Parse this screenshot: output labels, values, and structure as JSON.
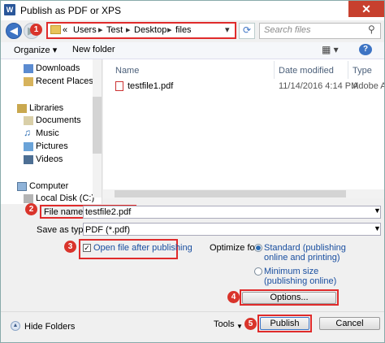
{
  "window": {
    "title": "Publish as PDF or XPS",
    "app_icon": "W",
    "close_glyph": "✕"
  },
  "address": {
    "crumbs": [
      "«",
      "Users",
      "Test",
      "Desktop",
      "files"
    ],
    "search_placeholder": "Search files"
  },
  "toolbar": {
    "organize": "Organize ▾",
    "new_folder": "New folder"
  },
  "sidebar": {
    "items": [
      {
        "label": "Downloads",
        "icon": "downloads-icon"
      },
      {
        "label": "Recent Places",
        "icon": "recent-places-icon"
      },
      {
        "label": "Libraries",
        "icon": "libraries-icon"
      },
      {
        "label": "Documents",
        "icon": "documents-icon"
      },
      {
        "label": "Music",
        "icon": "music-icon"
      },
      {
        "label": "Pictures",
        "icon": "pictures-icon"
      },
      {
        "label": "Videos",
        "icon": "videos-icon"
      },
      {
        "label": "Computer",
        "icon": "computer-icon"
      },
      {
        "label": "Local Disk (C:)",
        "icon": "disk-icon"
      }
    ]
  },
  "files": {
    "columns": [
      "Name",
      "Date modified",
      "Type"
    ],
    "rows": [
      {
        "name": "testfile1.pdf",
        "date": "11/14/2016 4:14 PM",
        "type": "Adobe Ac"
      }
    ]
  },
  "form": {
    "file_name_label": "File name:",
    "file_name_value": "testfile2.pdf",
    "save_type_label": "Save as type:",
    "save_type_value": "PDF (*.pdf)",
    "open_after_label": "Open file after publishing",
    "open_after_checked": true,
    "optimize_label": "Optimize for:",
    "standard_label_1": "Standard (publishing",
    "standard_label_2": "online and printing)",
    "minimum_label_1": "Minimum size",
    "minimum_label_2": "(publishing online)",
    "selected_optimize": "standard"
  },
  "buttons": {
    "options": "Options...",
    "tools": "Tools",
    "publish": "Publish",
    "cancel": "Cancel",
    "hide_folders": "Hide Folders"
  },
  "markers": [
    "1",
    "2",
    "3",
    "4",
    "5"
  ],
  "colors": {
    "accent": "#3d74c4",
    "marker": "#d9342b",
    "highlight_border": "#e02b2b"
  }
}
